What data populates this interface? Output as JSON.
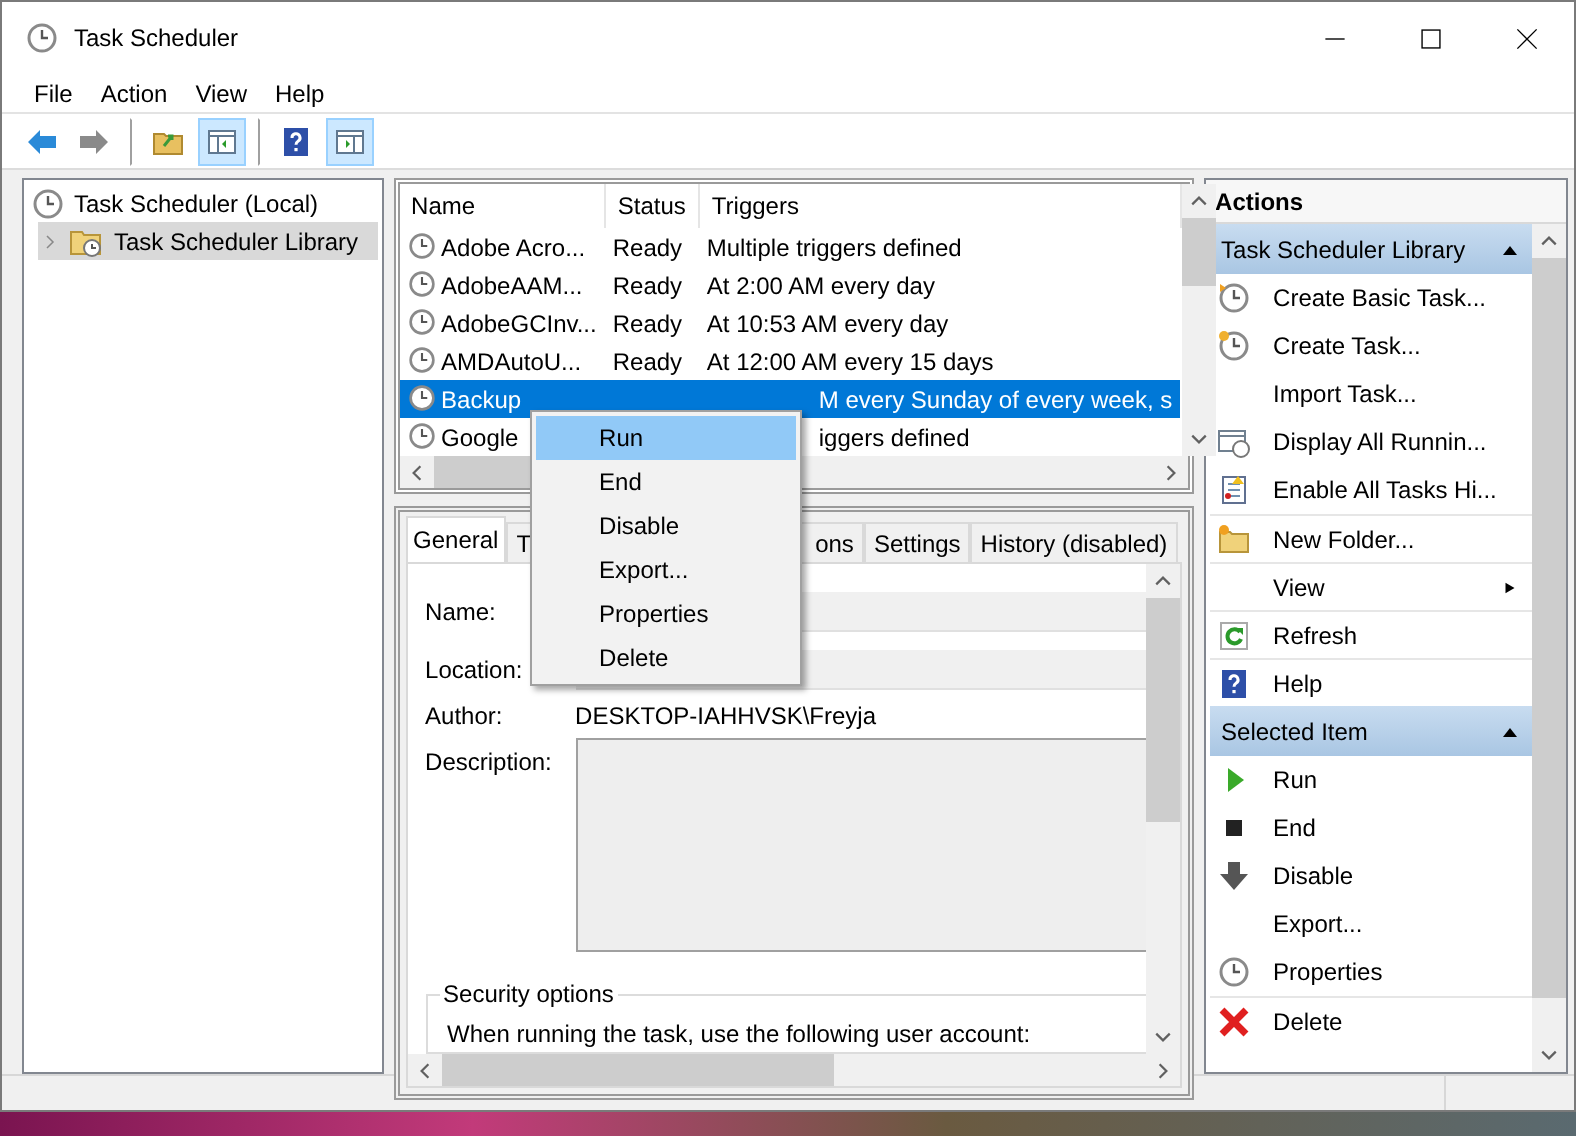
{
  "window": {
    "title": "Task Scheduler"
  },
  "menu_bar": [
    "File",
    "Action",
    "View",
    "Help"
  ],
  "toolbar": [
    {
      "kind": "back",
      "pressed": false,
      "divider_before": false
    },
    {
      "kind": "forward",
      "pressed": false,
      "divider_before": false
    },
    {
      "kind": "up-folder",
      "pressed": false,
      "divider_before": true
    },
    {
      "kind": "console-tree",
      "pressed": true,
      "divider_before": false
    },
    {
      "kind": "help",
      "pressed": false,
      "divider_before": true
    },
    {
      "kind": "action-pane",
      "pressed": true,
      "divider_before": false
    }
  ],
  "tree": [
    {
      "label": "Task Scheduler (Local)",
      "selected": false,
      "children": [
        {
          "label": "Task Scheduler Library",
          "selected": true,
          "expanded": false
        }
      ]
    }
  ],
  "task_list": {
    "columns": [
      "Name",
      "Status",
      "Triggers"
    ],
    "rows": [
      {
        "name": "Adobe Acro...",
        "status": "Ready",
        "triggers": "Multiple triggers defined",
        "selected": false,
        "covered": false
      },
      {
        "name": "AdobeAAM...",
        "status": "Ready",
        "triggers": "At 2:00 AM every day",
        "selected": false,
        "covered": false
      },
      {
        "name": "AdobeGCInv...",
        "status": "Ready",
        "triggers": "At 10:53 AM every day",
        "selected": false,
        "covered": false
      },
      {
        "name": "AMDAutoU...",
        "status": "Ready",
        "triggers": "At 12:00 AM every 15 days",
        "selected": false,
        "covered": false
      },
      {
        "name": "Backup",
        "triggers": "M every Sunday of every week, s",
        "selected": true,
        "covered": true
      },
      {
        "name": "Google",
        "triggers": "iggers defined",
        "selected": false,
        "covered": true
      }
    ]
  },
  "context_menu": [
    {
      "label": "Run",
      "selected": true
    },
    {
      "label": "End",
      "selected": false
    },
    {
      "label": "Disable",
      "selected": false
    },
    {
      "label": "Export...",
      "selected": false
    },
    {
      "label": "Properties",
      "selected": false
    },
    {
      "label": "Delete",
      "selected": false
    }
  ],
  "detail_tabs": [
    {
      "label": "General",
      "selected": true,
      "covered": false
    },
    {
      "label": "T",
      "selected": false,
      "covered": false
    },
    {
      "label": "ons",
      "selected": false,
      "covered": true
    },
    {
      "label": "Settings",
      "selected": false,
      "covered": false
    },
    {
      "label": "History (disabled)",
      "selected": false,
      "covered": false
    }
  ],
  "general": {
    "name_label": "Name:",
    "location_label": "Location:",
    "author_label": "Author:",
    "author": "DESKTOP-IAHHVSK\\Freyja",
    "description_label": "Description:",
    "security_title": "Security options",
    "security_text": "When running the task, use the following user account:"
  },
  "actions": {
    "title": "Actions",
    "sections": [
      {
        "title": "Task Scheduler Library",
        "expanded": true,
        "items": [
          {
            "label": "Create Basic Task...",
            "kind": "create-basic",
            "submenu": false,
            "divider_before": false
          },
          {
            "label": "Create Task...",
            "kind": "create",
            "submenu": false,
            "divider_before": false
          },
          {
            "label": "Import Task...",
            "kind": "none",
            "submenu": false,
            "divider_before": false
          },
          {
            "label": "Display All Runnin...",
            "kind": "display",
            "submenu": false,
            "divider_before": false
          },
          {
            "label": "Enable All Tasks Hi...",
            "kind": "history",
            "submenu": false,
            "divider_before": false
          },
          {
            "label": "New Folder...",
            "kind": "folder",
            "submenu": false,
            "divider_before": true
          },
          {
            "label": "View",
            "kind": "none",
            "submenu": true,
            "divider_before": true
          },
          {
            "label": "Refresh",
            "kind": "refresh",
            "submenu": false,
            "divider_before": true
          },
          {
            "label": "Help",
            "kind": "help",
            "submenu": false,
            "divider_before": true
          }
        ]
      },
      {
        "title": "Selected Item",
        "expanded": true,
        "items": [
          {
            "label": "Run",
            "kind": "run",
            "submenu": false,
            "divider_before": false
          },
          {
            "label": "End",
            "kind": "end",
            "submenu": false,
            "divider_before": false
          },
          {
            "label": "Disable",
            "kind": "disable",
            "submenu": false,
            "divider_before": false
          },
          {
            "label": "Export...",
            "kind": "none",
            "submenu": false,
            "divider_before": false
          },
          {
            "label": "Properties",
            "kind": "properties",
            "submenu": false,
            "divider_before": false
          },
          {
            "label": "Delete",
            "kind": "delete",
            "submenu": false,
            "divider_before": true
          }
        ]
      }
    ]
  }
}
